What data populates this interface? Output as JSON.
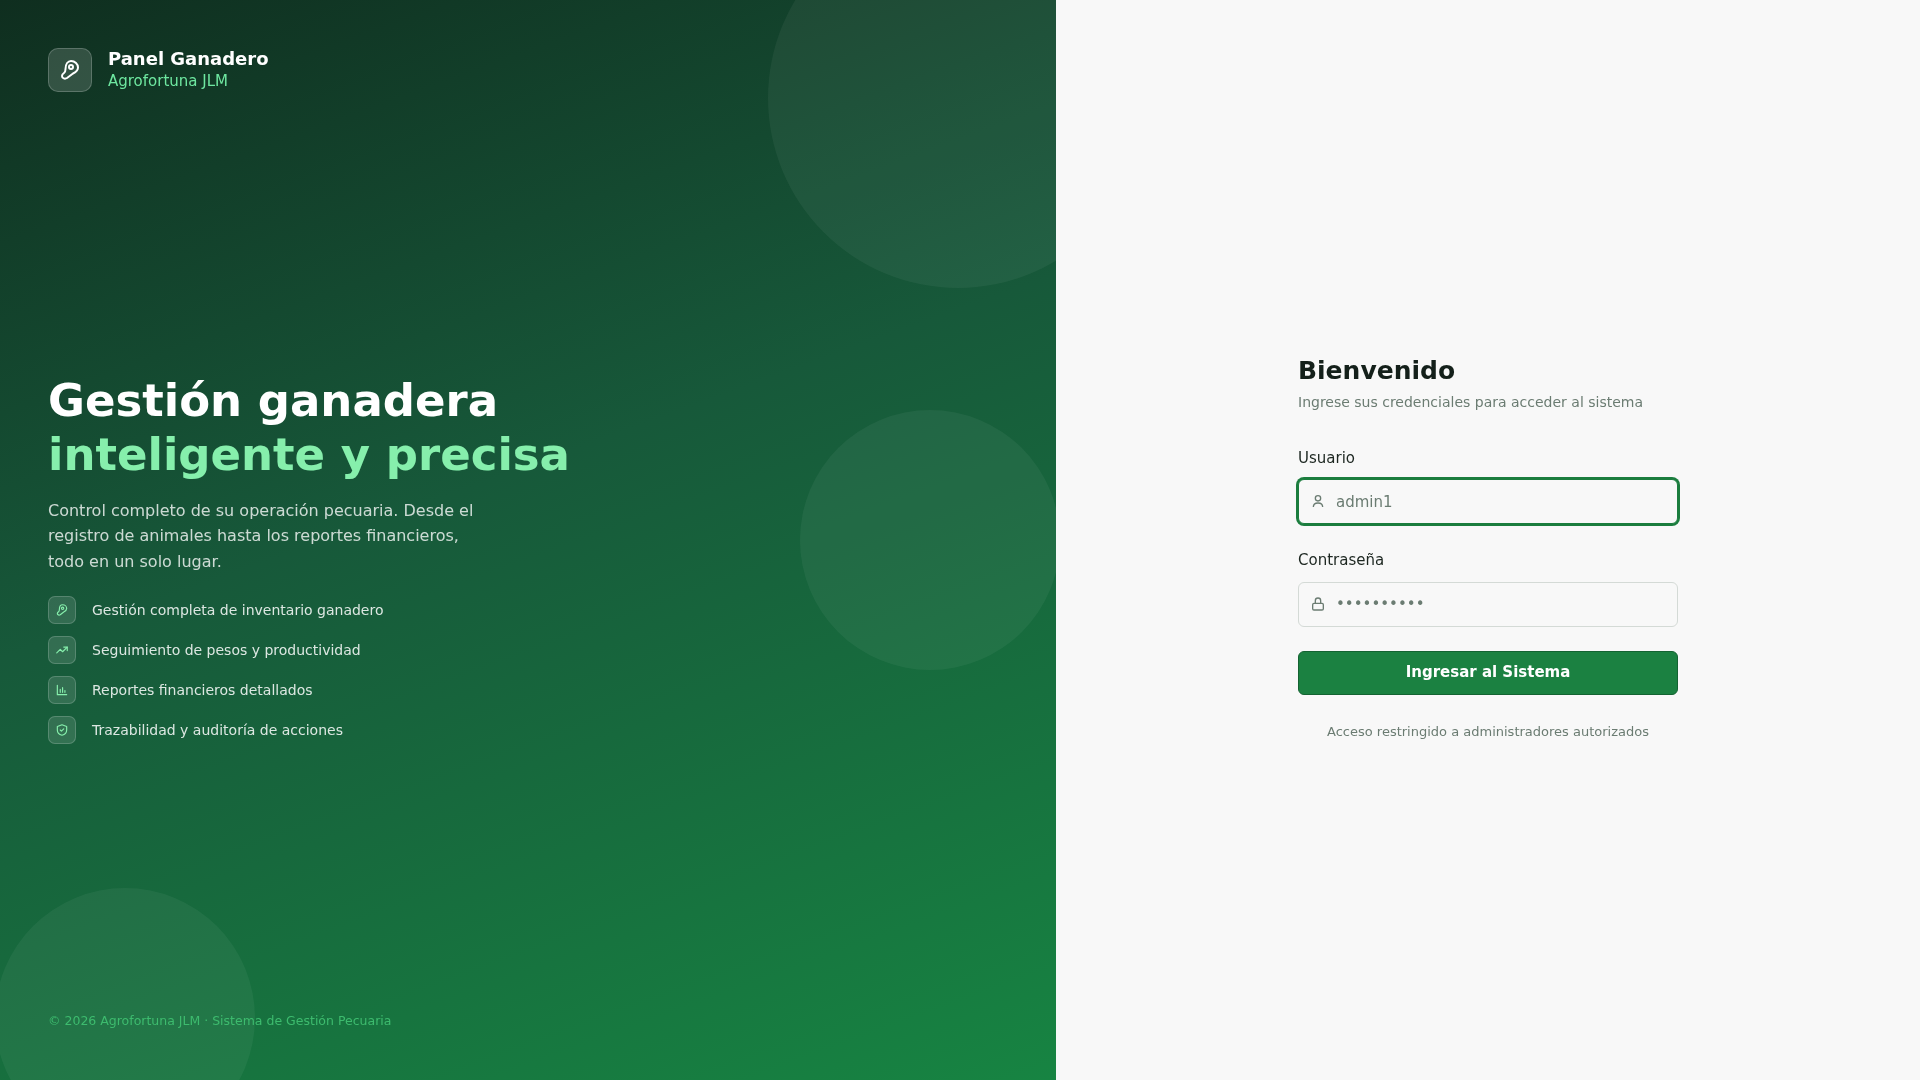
{
  "brand": {
    "title": "Panel Ganadero",
    "subtitle": "Agrofortuna JLM"
  },
  "hero": {
    "headline": "Gestión ganadera",
    "headline_accent": "inteligente y precisa",
    "description": "Control completo de su operación pecuaria. Desde el registro de animales hasta los reportes financieros, todo en un solo lugar."
  },
  "features": [
    {
      "kind": "steak",
      "label": "Gestión completa de inventario ganadero"
    },
    {
      "kind": "trend",
      "label": "Seguimiento de pesos y productividad"
    },
    {
      "kind": "bars",
      "label": "Reportes financieros detallados"
    },
    {
      "kind": "shield",
      "label": "Trazabilidad y auditoría de acciones"
    }
  ],
  "footer": "© 2026 Agrofortuna JLM · Sistema de Gestión Pecuaria",
  "login": {
    "title": "Bienvenido",
    "subtitle": "Ingrese sus credenciales para acceder al sistema",
    "fields": [
      {
        "kind": "user",
        "label": "Usuario",
        "placeholder": "admin1",
        "focused": true
      },
      {
        "kind": "lock",
        "label": "Contraseña",
        "placeholder": "••••••••••",
        "focused": false
      }
    ],
    "submit": "Ingresar al Sistema",
    "note": "Acceso restringido a administradores autorizados"
  }
}
